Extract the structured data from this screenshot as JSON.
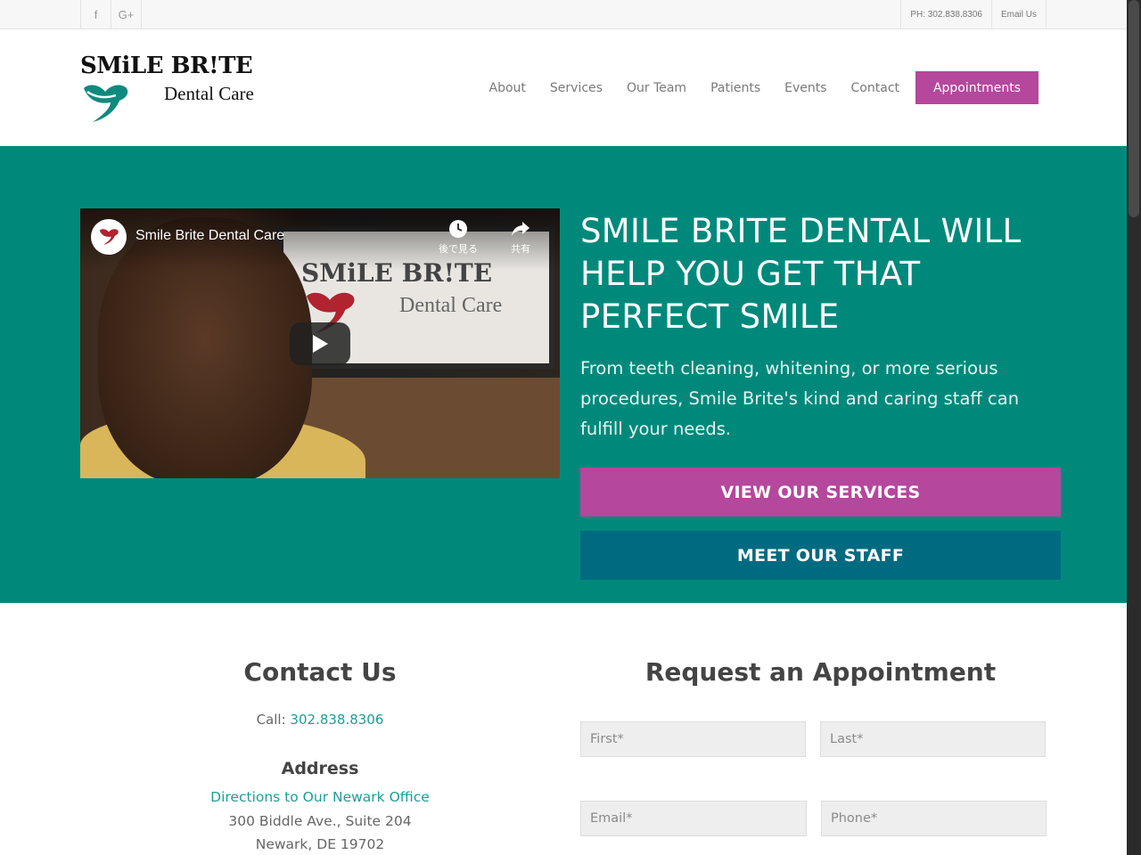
{
  "topbar": {
    "social": [
      {
        "icon": "facebook-icon",
        "glyph": "f"
      },
      {
        "icon": "google-plus-icon",
        "glyph": "G+"
      }
    ],
    "phone": "PH: 302.838.8306",
    "email": "Email Us"
  },
  "logo": {
    "line1": "SMiLE BR!TE",
    "line2": "Dental Care"
  },
  "nav": {
    "items": [
      "About",
      "Services",
      "Our Team",
      "Patients",
      "Events",
      "Contact"
    ],
    "cta": "Appointments"
  },
  "hero": {
    "video": {
      "title": "Smile Brite Dental Care",
      "watch_later": "後で見る",
      "share": "共有",
      "monitor_line1": "SMiLE BR!TE",
      "monitor_line2": "Dental Care"
    },
    "heading": "SMILE BRITE DENTAL WILL HELP YOU GET THAT PERFECT SMILE",
    "lead": "From teeth cleaning, whitening, or more serious procedures, Smile Brite's kind and caring staff can fulfill your needs.",
    "button_services": "VIEW OUR SERVICES",
    "button_staff": "MEET OUR STAFF"
  },
  "contact": {
    "title": "Contact Us",
    "call_label": "Call:",
    "phone": "302.838.8306",
    "address_heading": "Address",
    "directions": "Directions to Our Newark Office",
    "address_line1": "300 Biddle Ave., Suite 204",
    "address_line2": "Newark, DE 19702"
  },
  "appointment": {
    "title": "Request an Appointment",
    "first_placeholder": "First*",
    "last_placeholder": "Last*",
    "email_placeholder": "Email*",
    "phone_placeholder": "Phone*"
  },
  "colors": {
    "teal": "#00897b",
    "magenta": "#b5479c",
    "dark_teal": "#006b80",
    "link": "#1a9e96"
  }
}
